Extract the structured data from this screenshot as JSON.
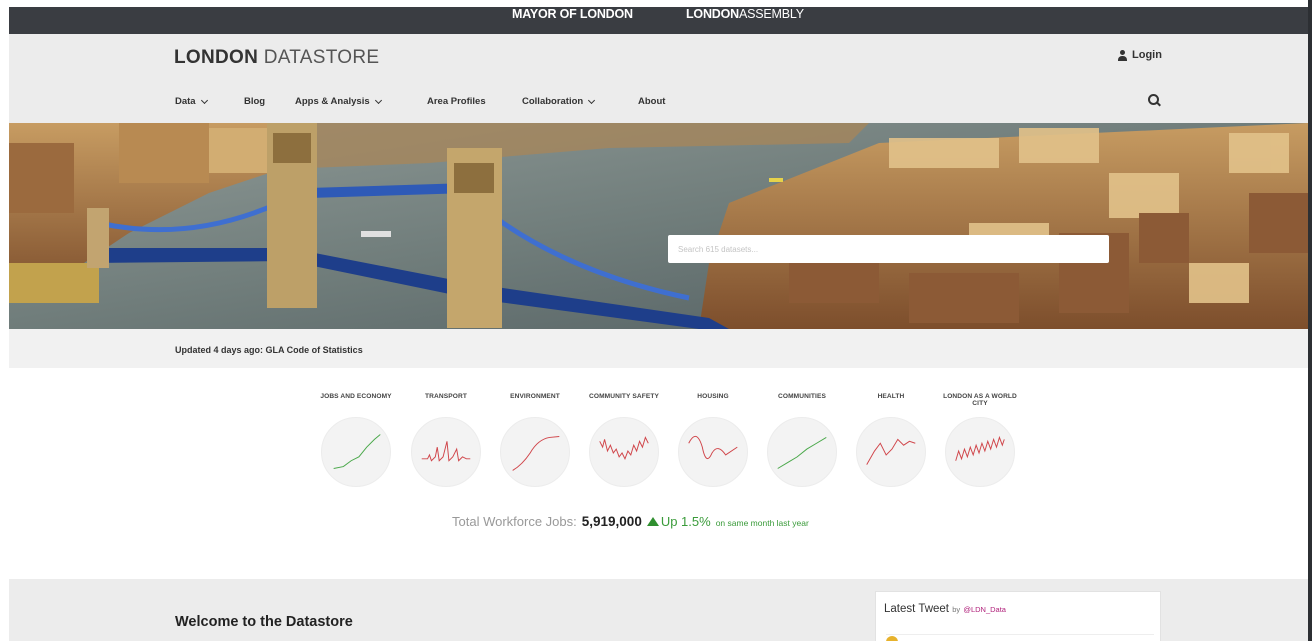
{
  "gla": {
    "mayor": "MAYOR OF LONDON",
    "assembly_bold": "LONDON",
    "assembly_light": "ASSEMBLY"
  },
  "header": {
    "brand_bold": "LONDON",
    "brand_light": " DATASTORE",
    "login_label": "Login"
  },
  "nav": {
    "items": [
      {
        "label": "Data",
        "dropdown": true
      },
      {
        "label": "Blog",
        "dropdown": false
      },
      {
        "label": "Apps & Analysis",
        "dropdown": true
      },
      {
        "label": "Area Profiles",
        "dropdown": false
      },
      {
        "label": "Collaboration",
        "dropdown": true
      },
      {
        "label": "About",
        "dropdown": false
      }
    ]
  },
  "hero": {
    "search_placeholder": "Search 615 datasets..."
  },
  "updated": {
    "text": "Updated 4 days ago: GLA Code of Statistics"
  },
  "categories": [
    {
      "label": "JOBS AND ECONOMY",
      "color": "#4aa84a"
    },
    {
      "label": "TRANSPORT",
      "color": "#d0454a"
    },
    {
      "label": "ENVIRONMENT",
      "color": "#d0454a"
    },
    {
      "label": "COMMUNITY SAFETY",
      "color": "#d0454a"
    },
    {
      "label": "HOUSING",
      "color": "#d0454a"
    },
    {
      "label": "COMMUNITIES",
      "color": "#4aa84a"
    },
    {
      "label": "HEALTH",
      "color": "#d0454a"
    },
    {
      "label": "LONDON AS A WORLD CITY",
      "color": "#d0454a"
    }
  ],
  "stat": {
    "label": "Total Workforce Jobs:",
    "value": "5,919,000",
    "up": "Up  1.5%",
    "note": "on same month last year"
  },
  "welcome": {
    "title": "Welcome to the Datastore"
  },
  "tweet": {
    "title": "Latest Tweet",
    "by": "by",
    "handle": "@LDN_Data"
  },
  "colors": {
    "gla_bar": "#3a3d42",
    "header_bg": "#ececec",
    "up_green": "#3a9b3a",
    "handle_pink": "#b0207a"
  }
}
